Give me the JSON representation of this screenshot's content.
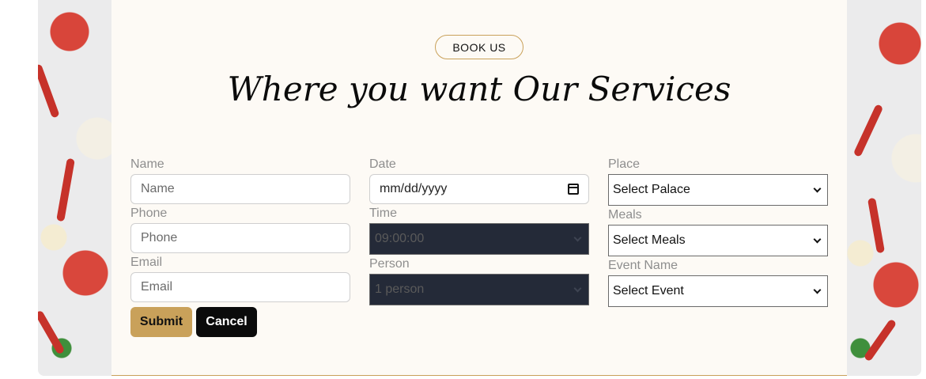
{
  "badge": "BOOK US",
  "title": "Where you want Our Services",
  "form": {
    "name_label": "Name",
    "name_placeholder": "Name",
    "phone_label": "Phone",
    "phone_placeholder": "Phone",
    "email_label": "Email",
    "email_placeholder": "Email",
    "date_label": "Date",
    "date_value": "mm/dd/yyyy",
    "time_label": "Time",
    "time_value": "09:00:00",
    "person_label": "Person",
    "person_value": "1 person",
    "place_label": "Place",
    "place_value": "Select Palace",
    "meals_label": "Meals",
    "meals_value": "Select Meals",
    "event_label": "Event Name",
    "event_value": "Select Event",
    "submit": "Submit",
    "cancel": "Cancel"
  },
  "colors": {
    "accent": "#c9a15a",
    "submit_bg": "#c9a15a",
    "cancel_bg": "#0b0b0b",
    "dark_select": "#242a38",
    "panel_bg": "#fdfaf5"
  },
  "icons": [
    "calendar-icon",
    "chevron-down-icon"
  ]
}
